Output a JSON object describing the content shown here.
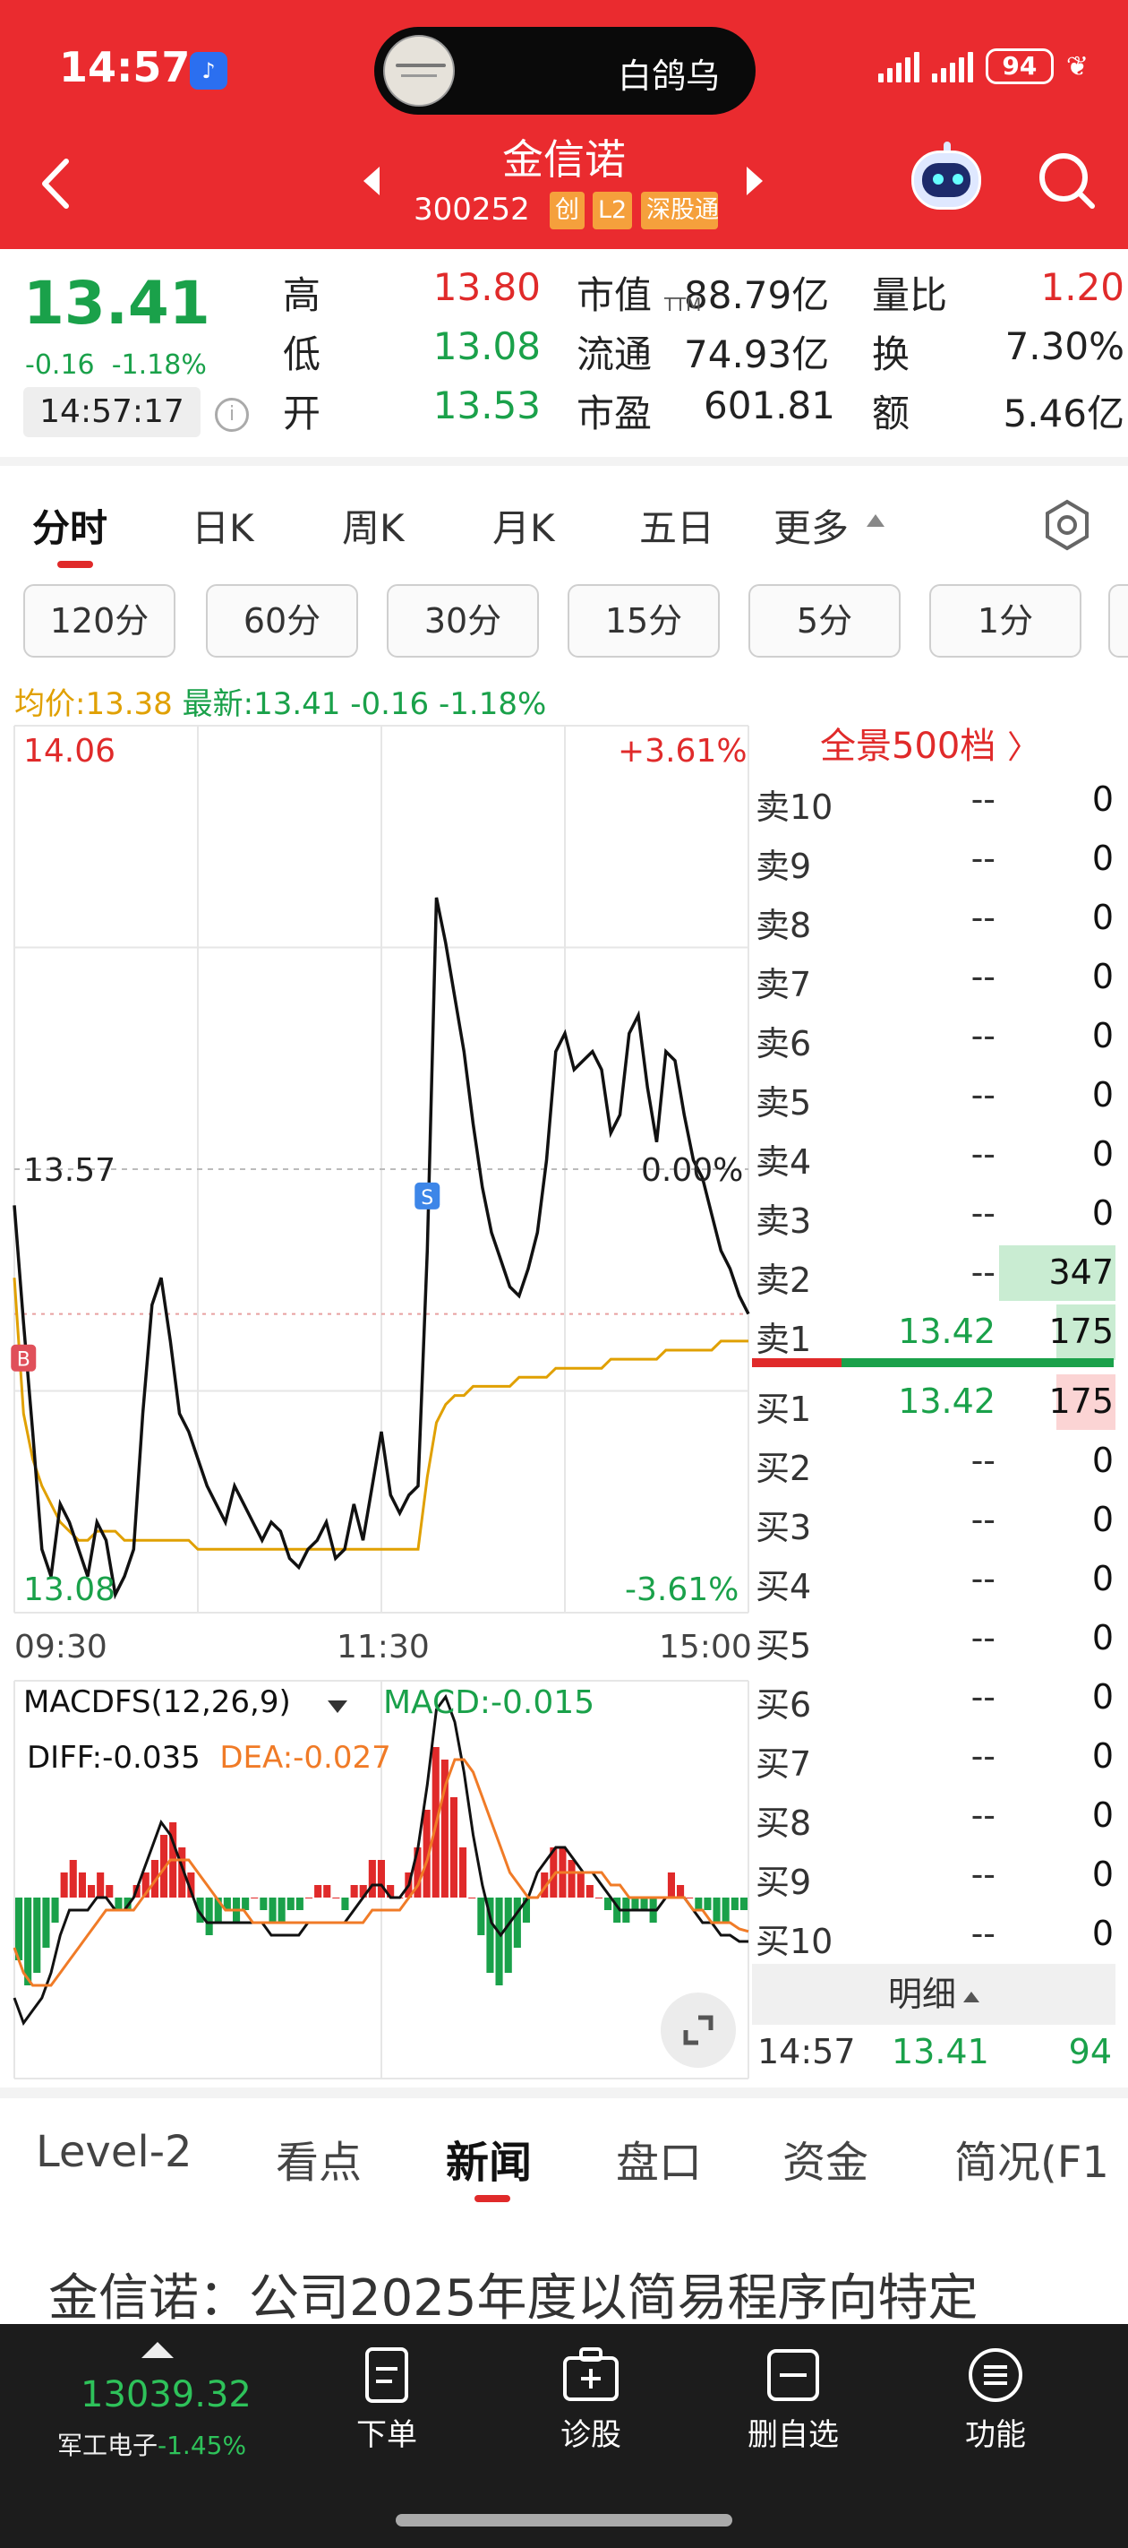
{
  "status_bar": {
    "time": "14:57",
    "island_text": "白鸽乌",
    "battery": "94"
  },
  "header": {
    "stock_name": "金信诺",
    "stock_code": "300252",
    "tags": [
      "创",
      "L2",
      "深股通"
    ]
  },
  "quote": {
    "price": "13.41",
    "change": "-0.16",
    "change_pct": "-1.18%",
    "time": "14:57:17",
    "rows": [
      {
        "k1": "高",
        "v1": "13.80",
        "k2": "市值",
        "v2": "88.79亿",
        "k3": "量比",
        "v3": "1.20"
      },
      {
        "k1": "低",
        "v1": "13.08",
        "k2": "流通",
        "v2": "74.93亿",
        "k3": "换",
        "v3": "7.30%"
      },
      {
        "k1": "开",
        "v1": "13.53",
        "k2": "市盈",
        "v2": "601.81",
        "k3": "额",
        "v3": "5.46亿"
      }
    ],
    "ttm_label": "TTM"
  },
  "period_tabs": [
    "分时",
    "日K",
    "周K",
    "月K",
    "五日",
    "更多"
  ],
  "interval_pills": [
    "120分",
    "60分",
    "30分",
    "15分",
    "5分",
    "1分"
  ],
  "chart_info": {
    "avg_label": "均价:13.38",
    "latest_label": "最新:13.41",
    "latest_change": "-0.16",
    "latest_pct": "-1.18%"
  },
  "chart_data": {
    "type": "line",
    "x_ticks": [
      "09:30",
      "11:30",
      "15:00"
    ],
    "y_top": "14.06",
    "y_mid": "13.57",
    "y_bottom": "13.08",
    "pct_top": "+3.61%",
    "pct_mid": "0.00%",
    "pct_bottom": "-3.61%",
    "ylim": [
      13.08,
      14.06
    ],
    "markers": [
      "B",
      "S"
    ],
    "series": [
      {
        "values": [
          13.53,
          13.4,
          13.28,
          13.15,
          13.12,
          13.2,
          13.18,
          13.15,
          13.12,
          13.18,
          13.16,
          13.1,
          13.12,
          13.15,
          13.3,
          13.42,
          13.45,
          13.38,
          13.3,
          13.28,
          13.25,
          13.22,
          13.2,
          13.18,
          13.22,
          13.2,
          13.18,
          13.16,
          13.18,
          13.17,
          13.14,
          13.13,
          13.15,
          13.16,
          13.18,
          13.14,
          13.15,
          13.2,
          13.16,
          13.22,
          13.28,
          13.21,
          13.19,
          13.21,
          13.22,
          13.48,
          13.87,
          13.82,
          13.76,
          13.7,
          13.62,
          13.55,
          13.5,
          13.47,
          13.44,
          13.43,
          13.46,
          13.5,
          13.58,
          13.7,
          13.72,
          13.68,
          13.69,
          13.7,
          13.68,
          13.61,
          13.63,
          13.72,
          13.74,
          13.66,
          13.6,
          13.7,
          13.69,
          13.63,
          13.58,
          13.56,
          13.52,
          13.48,
          13.46,
          13.43,
          13.41
        ]
      },
      {
        "values": [
          13.45,
          13.3,
          13.25,
          13.22,
          13.2,
          13.18,
          13.17,
          13.16,
          13.16,
          13.17,
          13.17,
          13.17,
          13.16,
          13.16,
          13.16,
          13.16,
          13.16,
          13.16,
          13.16,
          13.16,
          13.15,
          13.15,
          13.15,
          13.15,
          13.15,
          13.15,
          13.15,
          13.15,
          13.15,
          13.15,
          13.15,
          13.15,
          13.15,
          13.15,
          13.15,
          13.15,
          13.15,
          13.15,
          13.15,
          13.15,
          13.15,
          13.15,
          13.15,
          13.15,
          13.15,
          13.23,
          13.29,
          13.31,
          13.32,
          13.32,
          13.33,
          13.33,
          13.33,
          13.33,
          13.33,
          13.34,
          13.34,
          13.34,
          13.34,
          13.35,
          13.35,
          13.35,
          13.35,
          13.35,
          13.35,
          13.36,
          13.36,
          13.36,
          13.36,
          13.36,
          13.36,
          13.37,
          13.37,
          13.37,
          13.37,
          13.37,
          13.37,
          13.38,
          13.38,
          13.38,
          13.38
        ]
      }
    ]
  },
  "macd": {
    "title": "MACDFS(12,26,9)",
    "macd": "MACD:-0.015",
    "diff": "DIFF:-0.035",
    "dea": "DEA:-0.027",
    "hist": [
      -0.05,
      -0.07,
      -0.06,
      -0.04,
      -0.02,
      0.02,
      0.03,
      0.02,
      0.01,
      0.02,
      0.01,
      -0.01,
      -0.01,
      0.01,
      0.02,
      0.03,
      0.05,
      0.06,
      0.04,
      0.02,
      -0.02,
      -0.03,
      -0.02,
      -0.01,
      -0.02,
      -0.01,
      0.0,
      -0.01,
      -0.02,
      -0.02,
      -0.01,
      -0.01,
      0.0,
      0.01,
      0.01,
      0.0,
      -0.01,
      0.01,
      0.01,
      0.03,
      0.03,
      0.01,
      0.0,
      0.02,
      0.04,
      0.07,
      0.12,
      0.11,
      0.08,
      0.04,
      0.0,
      -0.03,
      -0.06,
      -0.07,
      -0.06,
      -0.04,
      -0.02,
      0.0,
      0.02,
      0.04,
      0.04,
      0.03,
      0.02,
      0.01,
      0.0,
      -0.01,
      -0.02,
      -0.02,
      -0.01,
      -0.01,
      -0.02,
      0.0,
      0.02,
      0.01,
      0.0,
      -0.01,
      -0.01,
      -0.02,
      -0.02,
      -0.01,
      -0.01
    ],
    "diff_values": [
      -0.08,
      -0.1,
      -0.09,
      -0.08,
      -0.06,
      -0.03,
      -0.01,
      -0.01,
      -0.01,
      0.0,
      0.0,
      -0.01,
      -0.01,
      0.0,
      0.02,
      0.04,
      0.06,
      0.05,
      0.03,
      0.01,
      -0.01,
      -0.02,
      -0.02,
      -0.02,
      -0.02,
      -0.02,
      -0.02,
      -0.02,
      -0.03,
      -0.03,
      -0.03,
      -0.03,
      -0.02,
      -0.02,
      -0.02,
      -0.02,
      -0.02,
      -0.01,
      0.0,
      0.01,
      0.01,
      0.0,
      0.0,
      0.01,
      0.04,
      0.09,
      0.15,
      0.16,
      0.14,
      0.1,
      0.05,
      0.01,
      -0.02,
      -0.03,
      -0.02,
      -0.01,
      0.0,
      0.02,
      0.03,
      0.04,
      0.04,
      0.03,
      0.02,
      0.02,
      0.01,
      0.0,
      -0.01,
      -0.01,
      -0.01,
      -0.01,
      -0.01,
      0.0,
      0.0,
      0.0,
      -0.01,
      -0.02,
      -0.02,
      -0.03,
      -0.03,
      -0.035,
      -0.035
    ],
    "dea_values": [
      -0.04,
      -0.06,
      -0.07,
      -0.07,
      -0.07,
      -0.06,
      -0.05,
      -0.04,
      -0.03,
      -0.02,
      -0.01,
      -0.01,
      -0.01,
      -0.01,
      0.0,
      0.01,
      0.02,
      0.03,
      0.03,
      0.03,
      0.02,
      0.01,
      0.0,
      -0.01,
      -0.01,
      -0.01,
      -0.02,
      -0.02,
      -0.02,
      -0.02,
      -0.02,
      -0.02,
      -0.02,
      -0.02,
      -0.02,
      -0.02,
      -0.02,
      -0.02,
      -0.02,
      -0.01,
      -0.01,
      -0.01,
      -0.01,
      0.0,
      0.01,
      0.03,
      0.06,
      0.09,
      0.11,
      0.11,
      0.1,
      0.08,
      0.06,
      0.04,
      0.02,
      0.01,
      0.0,
      0.0,
      0.01,
      0.02,
      0.02,
      0.02,
      0.02,
      0.02,
      0.02,
      0.01,
      0.01,
      0.0,
      0.0,
      0.0,
      0.0,
      0.0,
      0.0,
      0.0,
      -0.01,
      -0.01,
      -0.02,
      -0.02,
      -0.02,
      -0.025,
      -0.027
    ]
  },
  "order_book": {
    "title": "全景500档",
    "sells": [
      {
        "label": "卖10",
        "price": "--",
        "vol": "0"
      },
      {
        "label": "卖9",
        "price": "--",
        "vol": "0"
      },
      {
        "label": "卖8",
        "price": "--",
        "vol": "0"
      },
      {
        "label": "卖7",
        "price": "--",
        "vol": "0"
      },
      {
        "label": "卖6",
        "price": "--",
        "vol": "0"
      },
      {
        "label": "卖5",
        "price": "--",
        "vol": "0"
      },
      {
        "label": "卖4",
        "price": "--",
        "vol": "0"
      },
      {
        "label": "卖3",
        "price": "--",
        "vol": "0"
      },
      {
        "label": "卖2",
        "price": "--",
        "vol": "347"
      },
      {
        "label": "卖1",
        "price": "13.42",
        "vol": "175"
      }
    ],
    "buys": [
      {
        "label": "买1",
        "price": "13.42",
        "vol": "175"
      },
      {
        "label": "买2",
        "price": "--",
        "vol": "0"
      },
      {
        "label": "买3",
        "price": "--",
        "vol": "0"
      },
      {
        "label": "买4",
        "price": "--",
        "vol": "0"
      },
      {
        "label": "买5",
        "price": "--",
        "vol": "0"
      },
      {
        "label": "买6",
        "price": "--",
        "vol": "0"
      },
      {
        "label": "买7",
        "price": "--",
        "vol": "0"
      },
      {
        "label": "买8",
        "price": "--",
        "vol": "0"
      },
      {
        "label": "买9",
        "price": "--",
        "vol": "0"
      },
      {
        "label": "买10",
        "price": "--",
        "vol": "0"
      }
    ],
    "detail_label": "明细",
    "tick": {
      "time": "14:57",
      "price": "13.41",
      "vol": "94"
    }
  },
  "bottom_tabs": [
    "Level-2",
    "看点",
    "新闻",
    "盘口",
    "资金",
    "简况(F1"
  ],
  "news_headline": "金信诺：公司2025年度以简易程序向特定",
  "footer": {
    "index_value": "13039.32",
    "index_name": "军工电子",
    "index_change": "-1.45%",
    "buttons": [
      "下单",
      "诊股",
      "删自选",
      "功能"
    ]
  },
  "colors": {
    "header_red": "#ea2b2f",
    "up_red": "#e02a2a",
    "down_green": "#1aa14a",
    "avg_yellow": "#e0a000",
    "footer_bg": "#1c1c1c"
  }
}
